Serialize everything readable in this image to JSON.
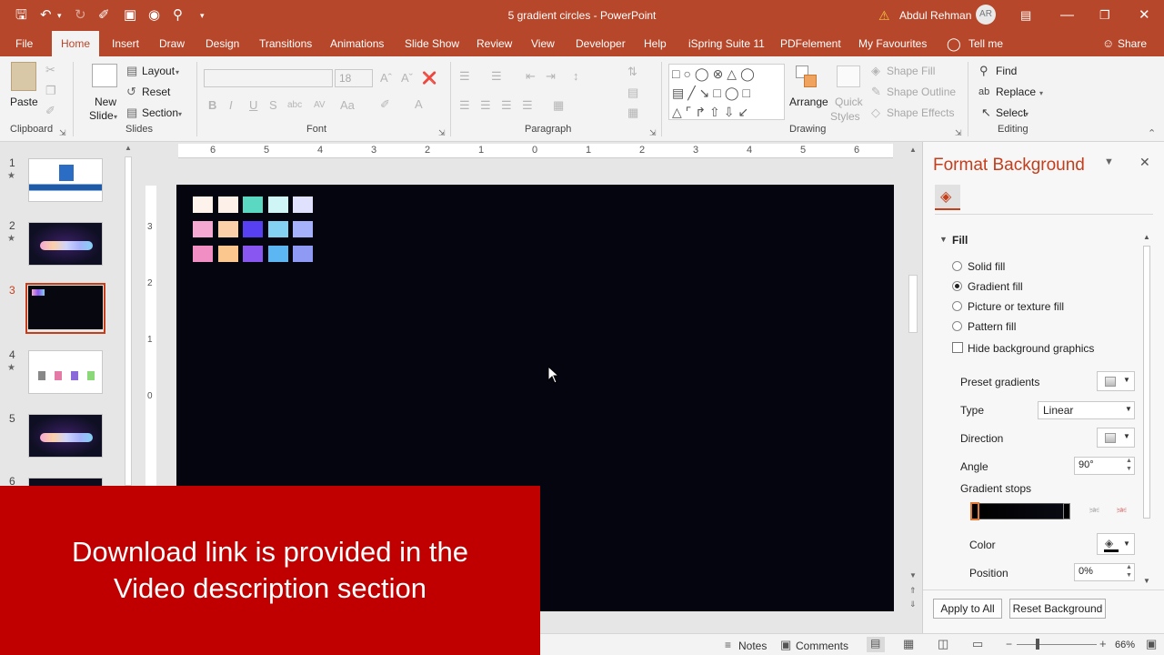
{
  "window": {
    "title": "5 gradient circles - PowerPoint",
    "user_name": "Abdul Rehman",
    "user_initials": "AR"
  },
  "tabs": [
    "File",
    "Home",
    "Insert",
    "Draw",
    "Design",
    "Transitions",
    "Animations",
    "Slide Show",
    "Review",
    "View",
    "Developer",
    "Help",
    "iSpring Suite 11",
    "PDFelement",
    "My Favourites",
    "Tell me",
    "Share"
  ],
  "ribbon": {
    "clipboard": {
      "paste": "Paste",
      "group": "Clipboard"
    },
    "slides": {
      "new_slide_1": "New",
      "new_slide_2": "Slide",
      "layout": "Layout",
      "reset": "Reset",
      "section": "Section",
      "group": "Slides"
    },
    "font": {
      "size": "18",
      "group": "Font"
    },
    "paragraph": {
      "group": "Paragraph"
    },
    "drawing": {
      "arrange": "Arrange",
      "quick_styles_1": "Quick",
      "quick_styles_2": "Styles",
      "shape_fill": "Shape Fill",
      "shape_outline": "Shape Outline",
      "shape_effects": "Shape Effects",
      "group": "Drawing"
    },
    "editing": {
      "find": "Find",
      "replace": "Replace",
      "select": "Select",
      "group": "Editing"
    }
  },
  "thumbnails": [
    "1",
    "2",
    "3",
    "4",
    "5",
    "6"
  ],
  "ruler_top": [
    "6",
    "5",
    "4",
    "3",
    "2",
    "1",
    "0",
    "1",
    "2",
    "3",
    "4",
    "5",
    "6"
  ],
  "ruler_left": [
    "3",
    "2",
    "1",
    "0"
  ],
  "slide": {
    "swatch_colors": [
      [
        "#fdf2ec",
        "#fdf0e8",
        "#5ad8c1",
        "#cff5f7",
        "#dfe1fd"
      ],
      [
        "#f4a8d2",
        "#fcd0a8",
        "#5640f2",
        "#83d1f3",
        "#a6b1fb"
      ],
      [
        "#f18fc5",
        "#fbc78f",
        "#8a56f1",
        "#5bb6f1",
        "#8f9af4"
      ]
    ]
  },
  "banner": {
    "line1": "Download link is provided in the",
    "line2": "Video description section"
  },
  "format_background": {
    "title": "Format Background",
    "fill_header": "Fill",
    "options": [
      "Solid fill",
      "Gradient fill",
      "Picture or texture fill",
      "Pattern fill"
    ],
    "selected": "Gradient fill",
    "hide_bg": "Hide background graphics",
    "preset_gradients": "Preset gradients",
    "type_label": "Type",
    "type_value": "Linear",
    "direction_label": "Direction",
    "angle_label": "Angle",
    "angle_value": "90°",
    "stops_label": "Gradient stops",
    "color_label": "Color",
    "position_label": "Position",
    "position_value": "0%",
    "apply_all": "Apply to All",
    "reset_bg": "Reset Background"
  },
  "status": {
    "notes": "Notes",
    "comments": "Comments",
    "zoom": "66%"
  }
}
